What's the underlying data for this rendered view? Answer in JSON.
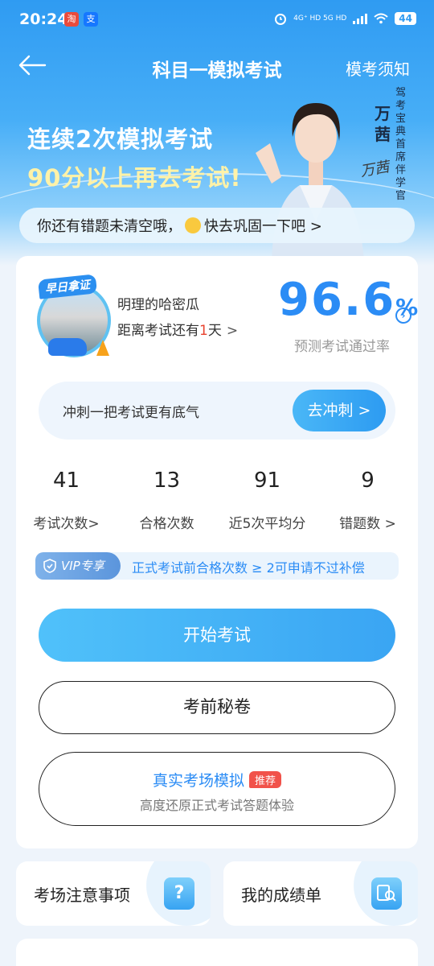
{
  "status_bar": {
    "time": "20:24",
    "network": "4G⁺ HD  5G HD",
    "battery": "44"
  },
  "nav": {
    "title": "科目一模拟考试",
    "notice": "模考须知"
  },
  "banner": {
    "line1": "连续2次模拟考试",
    "line2": "90分以上再去考试!",
    "name": "万茜",
    "role": "驾考宝典首席伴学官",
    "signature": "万茜"
  },
  "error_tip": {
    "before": "你还有错题未清空哦，",
    "after": "快去巩固一下吧 >"
  },
  "profile": {
    "badge": "早日拿证",
    "user_name": "明理的哈密瓜",
    "days_prefix": "距离考试还有",
    "days_num": "1",
    "days_suffix": "天",
    "chevron": ">"
  },
  "prediction": {
    "rate": "96.6",
    "unit": "%",
    "label": "预测考试通过率"
  },
  "sprint": {
    "text": "冲刺一把考试更有底气",
    "button": "去冲刺 >"
  },
  "stats": [
    {
      "value": "41",
      "label": "考试次数>"
    },
    {
      "value": "13",
      "label": "合格次数"
    },
    {
      "value": "91",
      "label": "近5次平均分"
    },
    {
      "value": "9",
      "label": "错题数 >"
    }
  ],
  "vip": {
    "tag": "VIP专享",
    "text": "正式考试前合格次数 ≥ 2可申请不过补偿"
  },
  "actions": {
    "start": "开始考试",
    "secret": "考前秘卷",
    "real_title": "真实考场模拟",
    "real_badge": "推荐",
    "real_sub": "高度还原正式考试答题体验"
  },
  "shortcuts": [
    {
      "label": "考场注意事项",
      "icon": "?"
    },
    {
      "label": "我的成绩单",
      "icon": "search-doc"
    }
  ],
  "colors": {
    "primary": "#2b8cf5",
    "highlight_yellow": "#fff2a8",
    "red": "#e8432f"
  }
}
